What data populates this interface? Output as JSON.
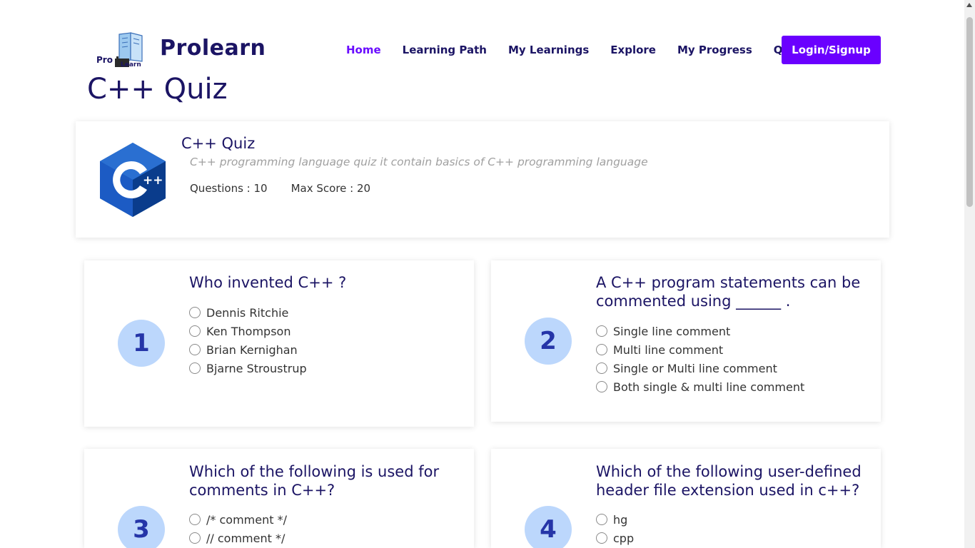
{
  "brand": {
    "name": "Prolearn",
    "logo_text_pro": "Pro",
    "logo_text_learn": "Learn"
  },
  "nav": {
    "items": [
      {
        "label": "Home",
        "active": true
      },
      {
        "label": "Learning Path",
        "active": false
      },
      {
        "label": "My Learnings",
        "active": false
      },
      {
        "label": "Explore",
        "active": false
      },
      {
        "label": "My Progress",
        "active": false
      },
      {
        "label": "Quiz",
        "active": false
      }
    ],
    "login_label": "Login/Signup"
  },
  "page_title": "C++ Quiz",
  "quiz": {
    "title": "C++ Quiz",
    "description": "C++ programming language quiz it contain basics of C++ programming language",
    "questions_text": "Questions : 10",
    "max_score_text": "Max Score : 20",
    "icon": "cpp-logo"
  },
  "questions": [
    {
      "number": "1",
      "text": "Who invented C++ ?",
      "options": [
        "Dennis Ritchie",
        "Ken Thompson",
        "Brian Kernighan",
        "Bjarne Stroustrup"
      ]
    },
    {
      "number": "2",
      "text": "A C++ program statements can be commented using ______ .",
      "options": [
        "Single line comment",
        "Multi line comment",
        "Single or Multi line comment",
        "Both single & multi line comment"
      ]
    },
    {
      "number": "3",
      "text": "Which of the following is used for comments in C++?",
      "options": [
        "/* comment */",
        "// comment */"
      ]
    },
    {
      "number": "4",
      "text": "Which of the following user-defined header file extension used in c++?",
      "options": [
        "hg",
        "cpp"
      ]
    }
  ],
  "colors": {
    "primary": "#6a00ff",
    "navy": "#1b1464",
    "circle": "#bcd7fc",
    "circle_text": "#2535a8"
  }
}
